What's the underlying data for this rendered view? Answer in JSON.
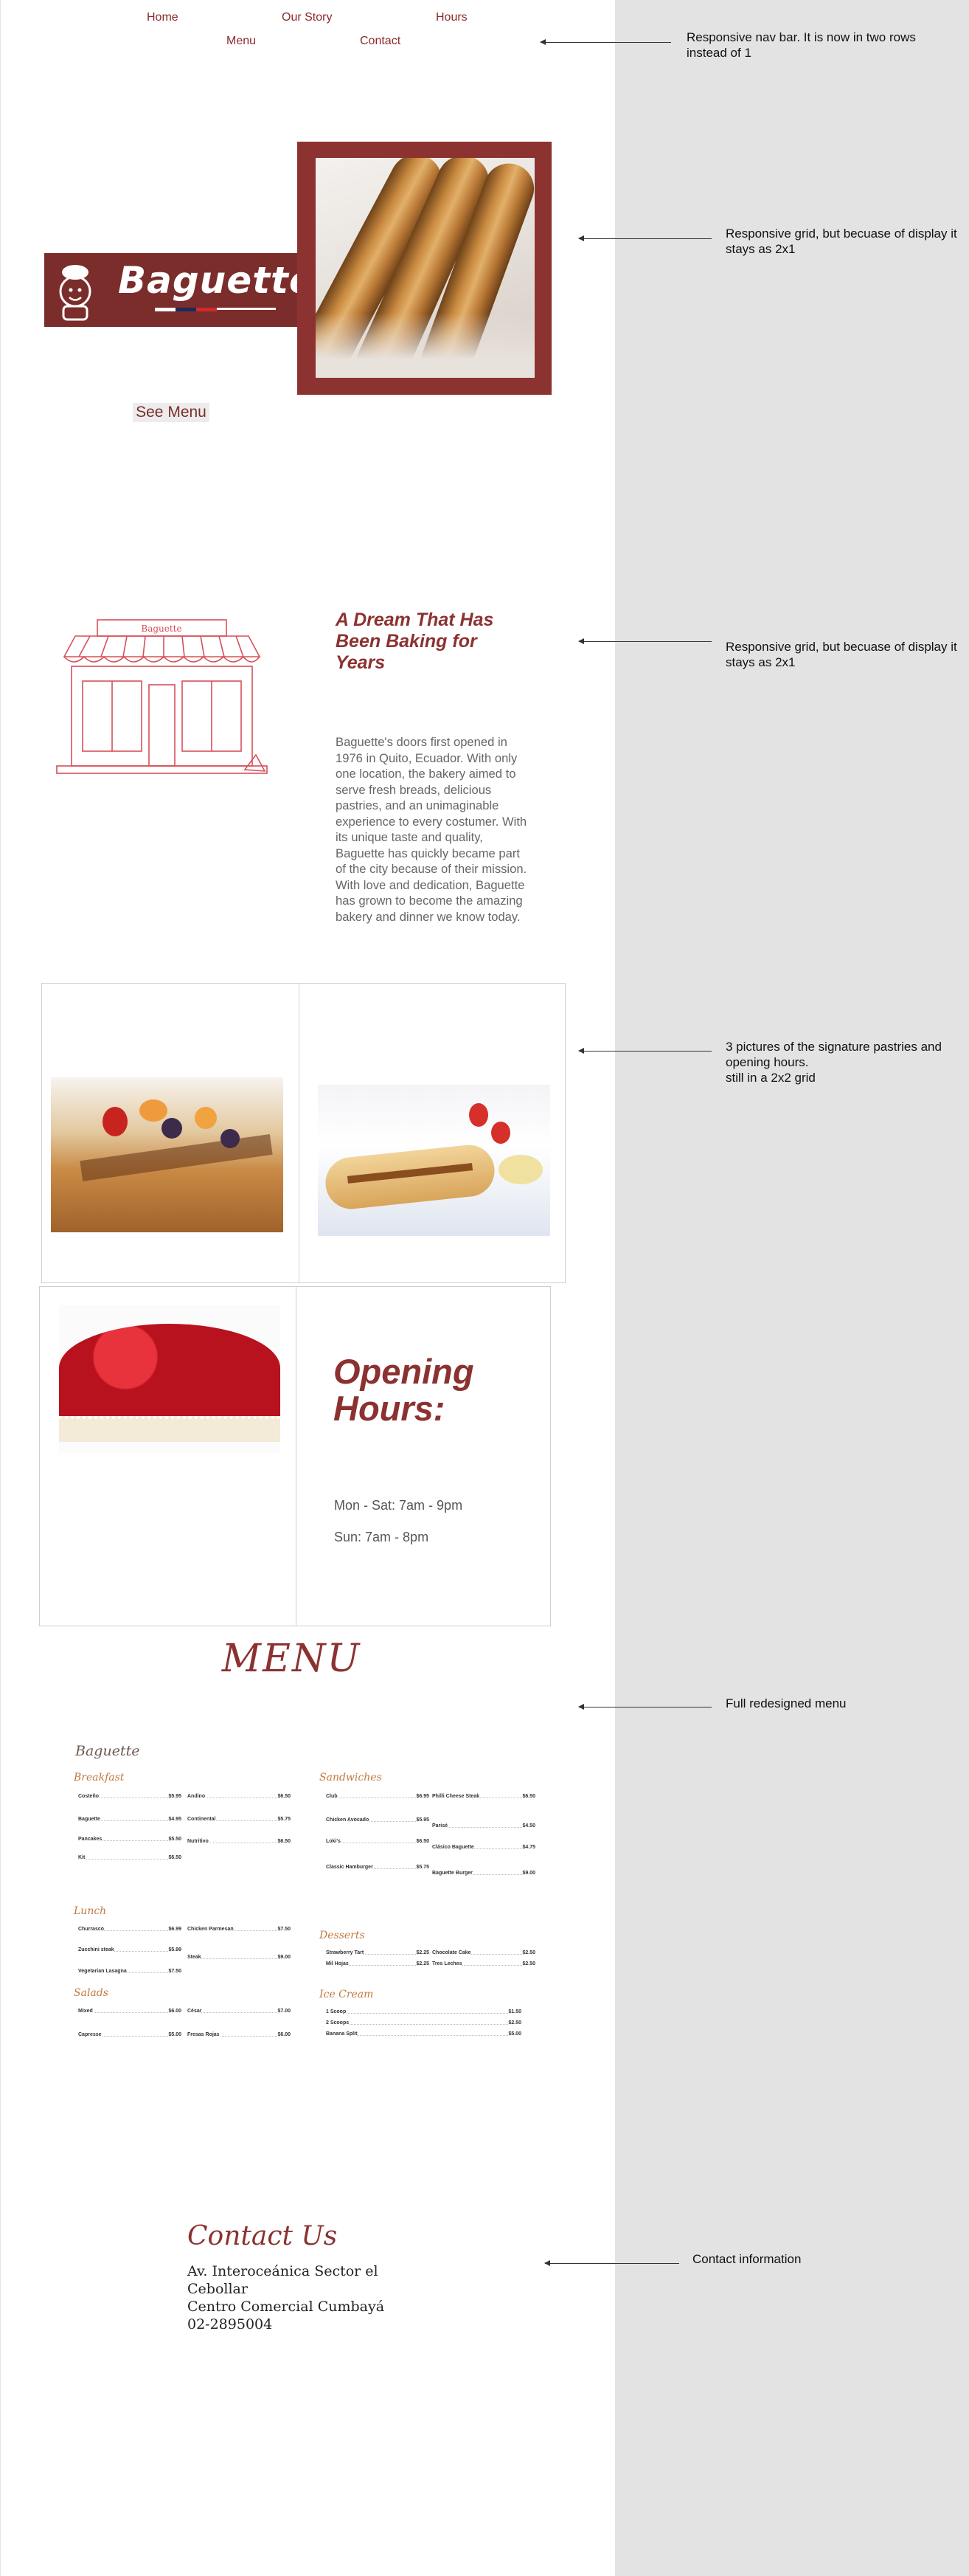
{
  "nav": {
    "home": "Home",
    "our_story": "Our Story",
    "hours": "Hours",
    "menu": "Menu",
    "contact": "Contact"
  },
  "annotations": {
    "nav": "Responsive nav bar. It is now in two rows instead of 1",
    "hero": "Responsive grid, but becuase of display it stays as 2x1",
    "story": "Responsive grid, but becuase of display it stays as 2x1",
    "pastries": "3 pictures of the signature pastries and opening hours.\nstill in a 2x2 grid",
    "menu": "Full redesigned menu",
    "contact": "Contact information"
  },
  "hero": {
    "logo_text": "Baguette",
    "see_menu": "See Menu"
  },
  "story": {
    "sign_text": "Baguette",
    "title": "A Dream That Has Been Baking for Years",
    "body": "Baguette's doors first opened in 1976 in Quito, Ecuador. With only one location, the bakery aimed to serve fresh breads, delicious pastries, and an unimaginable experience to every costumer. With its unique taste and quality, Baguette has quickly became part of the city because of their mission. With love and dedication, Baguette has grown to become the amazing bakery and dinner we know today."
  },
  "hours": {
    "title": "Opening Hours:",
    "weekdays": "Mon - Sat: 7am - 9pm",
    "sunday": "Sun: 7am - 8pm"
  },
  "menu": {
    "heading": "MENU",
    "brand": "Baguette",
    "breakfast": {
      "title": "Breakfast",
      "items": [
        {
          "name": "Costeño",
          "price": "$5.95"
        },
        {
          "name": "Andino",
          "price": "$6.50"
        },
        {
          "name": "Baguette",
          "price": "$4.95"
        },
        {
          "name": "Continental",
          "price": "$5.75"
        },
        {
          "name": "Pancakes",
          "price": "$5.50"
        },
        {
          "name": "Nutritivo",
          "price": "$6.50"
        },
        {
          "name": "Kit",
          "price": "$6.50"
        }
      ]
    },
    "sandwiches": {
      "title": "Sandwiches",
      "items": [
        {
          "name": "Club",
          "price": "$6.95"
        },
        {
          "name": "Philli Cheese Steak",
          "price": "$6.50"
        },
        {
          "name": "Chicken Avocado",
          "price": "$5.95"
        },
        {
          "name": "Parisé",
          "price": "$4.50"
        },
        {
          "name": "Loki's",
          "price": "$6.50"
        },
        {
          "name": "Clásico Baguette",
          "price": "$4.75"
        },
        {
          "name": "Classic Hamburger",
          "price": "$5.75"
        },
        {
          "name": "Baguette Burger",
          "price": "$9.00"
        }
      ]
    },
    "lunch": {
      "title": "Lunch",
      "items": [
        {
          "name": "Churrasco",
          "price": "$6.99"
        },
        {
          "name": "Chicken Parmesan",
          "price": "$7.50"
        },
        {
          "name": "Zucchini steak",
          "price": "$5.99"
        },
        {
          "name": "Steak",
          "price": "$9.00"
        },
        {
          "name": "Vegetarian Lasagna",
          "price": "$7.50"
        }
      ]
    },
    "desserts": {
      "title": "Desserts",
      "items": [
        {
          "name": "Strawberry Tart",
          "price": "$2.25"
        },
        {
          "name": "Chocolate Cake",
          "price": "$2.50"
        },
        {
          "name": "Mil Hojas",
          "price": "$2.25"
        },
        {
          "name": "Tres Leches",
          "price": "$2.50"
        }
      ]
    },
    "salads": {
      "title": "Salads",
      "items": [
        {
          "name": "Mixed",
          "price": "$6.00"
        },
        {
          "name": "César",
          "price": "$7.00"
        },
        {
          "name": "Capresse",
          "price": "$5.00"
        },
        {
          "name": "Fresas Rojas",
          "price": "$6.00"
        }
      ]
    },
    "ice_cream": {
      "title": "Ice Cream",
      "items": [
        {
          "name": "1 Scoop",
          "price": "$1.50"
        },
        {
          "name": "2 Scoops",
          "price": "$2.50"
        },
        {
          "name": "Banana Split",
          "price": "$5.00"
        }
      ]
    }
  },
  "contact": {
    "title": "Contact Us",
    "address_1": "Av. Interoceánica Sector el",
    "address_2": "Cebollar",
    "address_3": "Centro Comercial Cumbayá",
    "phone": "02-2895004"
  },
  "colors": {
    "brand": "#8b3231",
    "accent": "#c1793e",
    "panel": "#e3e3e3"
  }
}
